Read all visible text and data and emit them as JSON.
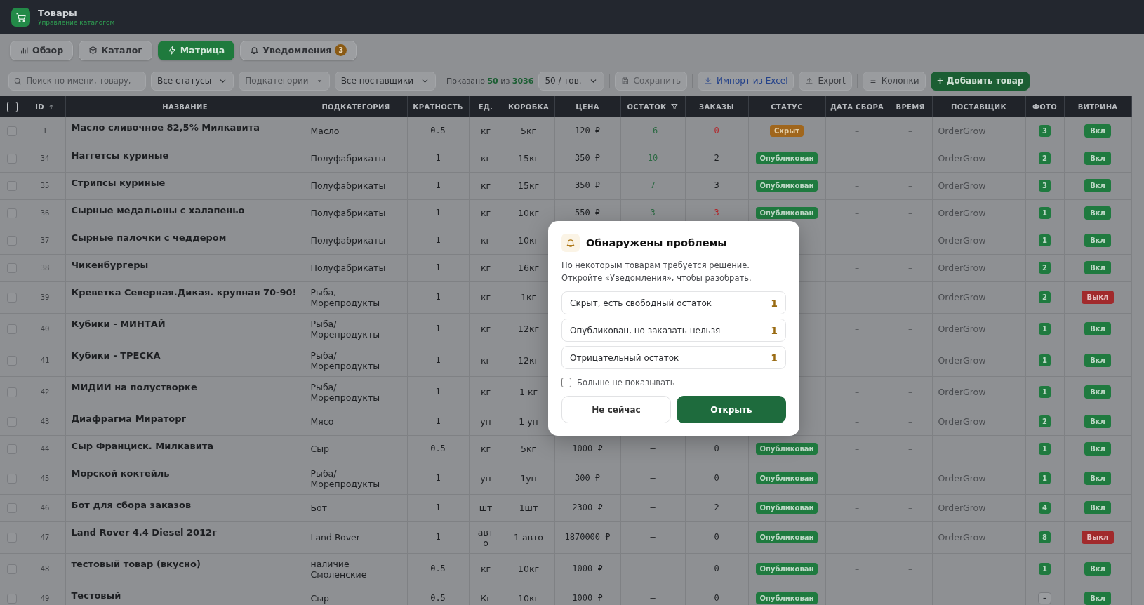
{
  "header": {
    "title": "Товары",
    "subtitle": "Управление каталогом"
  },
  "tabs": [
    {
      "label": "Обзор",
      "selected": false
    },
    {
      "label": "Каталог",
      "selected": false
    },
    {
      "label": "Матрица",
      "selected": true
    },
    {
      "label": "Уведомления",
      "selected": false,
      "badge": "3"
    }
  ],
  "toolbar": {
    "search": {
      "placeholder": "Поиск по имени, товару,"
    },
    "filters": [
      {
        "label": "Все статусы",
        "disabled": false
      },
      {
        "label": "Подкатегории",
        "disabled": true
      },
      {
        "label": "Все поставщики",
        "disabled": false
      }
    ],
    "shown": "Показано **50** из **3036**",
    "page_size": "50 / тов.",
    "actions": [
      {
        "label": "Сохранить",
        "kind": "save"
      },
      {
        "label": "Импорт из Excel",
        "kind": "import"
      },
      {
        "label": "Export",
        "kind": "export"
      },
      {
        "label": "Колонки",
        "kind": "columns"
      },
      {
        "label": "+ Добавить товар",
        "kind": "primary"
      }
    ]
  },
  "table": {
    "select_all": {
      "checked": false
    },
    "columns": [
      {
        "label": "ID",
        "kind": "sorted"
      },
      {
        "label": "НАЗВАНИЕ",
        "kind": "plain"
      },
      {
        "label": "ПОДКАТЕГОРИЯ",
        "kind": "plain"
      },
      {
        "label": "КРАТНОСТЬ",
        "kind": "plain"
      },
      {
        "label": "ЕД.",
        "kind": "plain"
      },
      {
        "label": "КОРОБКА",
        "kind": "plain"
      },
      {
        "label": "ЦЕНА",
        "kind": "plain"
      },
      {
        "label": "ОСТАТОК",
        "kind": "filter"
      },
      {
        "label": "ЗАКАЗЫ",
        "kind": "plain"
      },
      {
        "label": "СТАТУС",
        "kind": "plain"
      },
      {
        "label": "ДАТА СБОРА",
        "kind": "plain"
      },
      {
        "label": "ВРЕМЯ",
        "kind": "plain"
      },
      {
        "label": "ПОСТАВЩИК",
        "kind": "plain"
      },
      {
        "label": "ФОТО",
        "kind": "plain"
      },
      {
        "label": "ВИТРИНА",
        "kind": "plain"
      }
    ],
    "rows": [
      {
        "checked": false,
        "id": "1",
        "name": "Масло сливочное 82,5% Милкавита",
        "subcategory": "Масло",
        "multiple": "0.5",
        "unit": "кг",
        "box": "5кг",
        "price": "120 ₽",
        "stock": {
          "text": "-6",
          "color": "#2d6a44"
        },
        "orders": {
          "text": "0",
          "color": "#b3262b"
        },
        "status": {
          "kind": "hidden",
          "label": "Скрыт"
        },
        "collect_date": "–",
        "time": "–",
        "supplier": "OrderGrow",
        "photo": {
          "kind": "count",
          "text": "3"
        },
        "showcase": {
          "on": true,
          "label": "Вкл"
        }
      },
      {
        "checked": false,
        "id": "34",
        "name": "Наггетсы куриные",
        "subcategory": "Полуфабрикаты",
        "multiple": "1",
        "unit": "кг",
        "box": "15кг",
        "price": "350 ₽",
        "stock": {
          "text": "10",
          "color": "#2d6a44"
        },
        "orders": {
          "text": "2"
        },
        "status": {
          "kind": "published",
          "label": "Опубликован"
        },
        "collect_date": "–",
        "time": "–",
        "supplier": "OrderGrow",
        "photo": {
          "kind": "count",
          "text": "2"
        },
        "showcase": {
          "on": true,
          "label": "Вкл"
        }
      },
      {
        "checked": false,
        "id": "35",
        "name": "Стрипсы куриные",
        "subcategory": "Полуфабрикаты",
        "multiple": "1",
        "unit": "кг",
        "box": "15кг",
        "price": "350 ₽",
        "stock": {
          "text": "7",
          "color": "#2d6a44"
        },
        "orders": {
          "text": "3"
        },
        "status": {
          "kind": "published",
          "label": "Опубликован"
        },
        "collect_date": "–",
        "time": "–",
        "supplier": "OrderGrow",
        "photo": {
          "kind": "count",
          "text": "3"
        },
        "showcase": {
          "on": true,
          "label": "Вкл"
        }
      },
      {
        "checked": false,
        "id": "36",
        "name": "Сырные медальоны с халапеньо",
        "subcategory": "Полуфабрикаты",
        "multiple": "1",
        "unit": "кг",
        "box": "10кг",
        "price": "550 ₽",
        "stock": {
          "text": "3",
          "color": "#2d6a44"
        },
        "orders": {
          "text": "3",
          "color": "#b3262b"
        },
        "status": {
          "kind": "published",
          "label": "Опубликован"
        },
        "collect_date": "–",
        "time": "–",
        "supplier": "OrderGrow",
        "photo": {
          "kind": "count",
          "text": "1"
        },
        "showcase": {
          "on": true,
          "label": "Вкл"
        }
      },
      {
        "checked": false,
        "id": "37",
        "name": "Сырные палочки с чеддером",
        "subcategory": "Полуфабрикаты",
        "multiple": "1",
        "unit": "кг",
        "box": "10кг",
        "collect_date": "–",
        "time": "–",
        "supplier": "OrderGrow",
        "photo": {
          "kind": "count",
          "text": "1"
        },
        "showcase": {
          "on": true,
          "label": "Вкл"
        }
      },
      {
        "checked": false,
        "id": "38",
        "name": "Чикенбургеры",
        "subcategory": "Полуфабрикаты",
        "multiple": "1",
        "unit": "кг",
        "box": "16кг",
        "collect_date": "–",
        "time": "–",
        "supplier": "OrderGrow",
        "photo": {
          "kind": "count",
          "text": "2"
        },
        "showcase": {
          "on": true,
          "label": "Вкл"
        }
      },
      {
        "checked": false,
        "id": "39",
        "name": "Креветка Северная.Дикая. крупная 70-90!",
        "subcategory": "Рыба, Морепродукты",
        "multiple": "1",
        "unit": "кг",
        "box": "1кг",
        "collect_date": "–",
        "time": "–",
        "supplier": "OrderGrow",
        "photo": {
          "kind": "count",
          "text": "2"
        },
        "showcase": {
          "on": false,
          "label": "Выкл"
        }
      },
      {
        "checked": false,
        "id": "40",
        "name": "Кубики - МИНТАЙ",
        "subcategory": "Рыба/ Морепродукты",
        "multiple": "1",
        "unit": "кг",
        "box": "12кг",
        "collect_date": "–",
        "time": "–",
        "supplier": "OrderGrow",
        "photo": {
          "kind": "count",
          "text": "1"
        },
        "showcase": {
          "on": true,
          "label": "Вкл"
        }
      },
      {
        "checked": false,
        "id": "41",
        "name": "Кубики - ТРЕСКА",
        "subcategory": "Рыба/ Морепродукты",
        "multiple": "1",
        "unit": "кг",
        "box": "12кг",
        "collect_date": "–",
        "time": "–",
        "supplier": "OrderGrow",
        "photo": {
          "kind": "count",
          "text": "1"
        },
        "showcase": {
          "on": true,
          "label": "Вкл"
        }
      },
      {
        "checked": false,
        "id": "42",
        "name": "МИДИИ на полустворке",
        "subcategory": "Рыба/ Морепродукты",
        "multiple": "1",
        "unit": "кг",
        "box": "1 кг",
        "collect_date": "–",
        "time": "–",
        "supplier": "OrderGrow",
        "photo": {
          "kind": "count",
          "text": "1"
        },
        "showcase": {
          "on": true,
          "label": "Вкл"
        }
      },
      {
        "checked": false,
        "id": "43",
        "name": "Диафрагма Мираторг",
        "subcategory": "Мясо",
        "multiple": "1",
        "unit": "уп",
        "box": "1 уп",
        "collect_date": "–",
        "time": "–",
        "supplier": "OrderGrow",
        "photo": {
          "kind": "count",
          "text": "2"
        },
        "showcase": {
          "on": true,
          "label": "Вкл"
        }
      },
      {
        "checked": false,
        "id": "44",
        "name": "Сыр Франциск. Милкавита",
        "subcategory": "Сыр",
        "multiple": "0.5",
        "unit": "кг",
        "box": "5кг",
        "price": "1000 ₽",
        "stock": {
          "text": "–"
        },
        "orders": {
          "text": "0"
        },
        "status": {
          "kind": "published",
          "label": "Опубликован"
        },
        "collect_date": "–",
        "time": "–",
        "photo": {
          "kind": "count",
          "text": "1"
        },
        "showcase": {
          "on": true,
          "label": "Вкл"
        }
      },
      {
        "checked": false,
        "id": "45",
        "name": "Морской коктейль",
        "subcategory": "Рыба/ Морепродукты",
        "multiple": "1",
        "unit": "уп",
        "box": "1уп",
        "price": "300 ₽",
        "stock": {
          "text": "–"
        },
        "orders": {
          "text": "0"
        },
        "status": {
          "kind": "published",
          "label": "Опубликован"
        },
        "collect_date": "–",
        "time": "–",
        "supplier": "OrderGrow",
        "photo": {
          "kind": "count",
          "text": "1"
        },
        "showcase": {
          "on": true,
          "label": "Вкл"
        }
      },
      {
        "checked": false,
        "id": "46",
        "name": "Бот для сбора заказов",
        "subcategory": "Бот",
        "multiple": "1",
        "unit": "шт",
        "box": "1шт",
        "price": "2300 ₽",
        "stock": {
          "text": "–"
        },
        "orders": {
          "text": "2"
        },
        "status": {
          "kind": "published",
          "label": "Опубликован"
        },
        "collect_date": "–",
        "time": "–",
        "supplier": "OrderGrow",
        "photo": {
          "kind": "count",
          "text": "4"
        },
        "showcase": {
          "on": true,
          "label": "Вкл"
        }
      },
      {
        "checked": false,
        "id": "47",
        "name": "Land Rover 4.4 Diesel 2012г",
        "subcategory": "Land Rover",
        "multiple": "1",
        "unit": "авто",
        "box": "1 авто",
        "price": "1870000 ₽",
        "stock": {
          "text": "–"
        },
        "orders": {
          "text": "0"
        },
        "status": {
          "kind": "published",
          "label": "Опубликован"
        },
        "collect_date": "–",
        "time": "–",
        "supplier": "OrderGrow",
        "photo": {
          "kind": "count",
          "text": "8"
        },
        "showcase": {
          "on": false,
          "label": "Выкл"
        }
      },
      {
        "checked": false,
        "id": "48",
        "name": "тестовый товар (вкусно)",
        "subcategory": "наличие Смоленские",
        "multiple": "0.5",
        "unit": "кг",
        "box": "10кг",
        "price": "1000 ₽",
        "stock": {
          "text": "–"
        },
        "orders": {
          "text": "0"
        },
        "status": {
          "kind": "published",
          "label": "Опубликован"
        },
        "collect_date": "–",
        "time": "–",
        "photo": {
          "kind": "count",
          "text": "1"
        },
        "showcase": {
          "on": true,
          "label": "Вкл"
        }
      },
      {
        "checked": false,
        "id": "49",
        "name": "Тестовый",
        "subcategory": "Сыр",
        "multiple": "0.5",
        "unit": "Кг",
        "box": "10кг",
        "price": "1000 ₽",
        "stock": {
          "text": "–"
        },
        "orders": {
          "text": "0"
        },
        "status": {
          "kind": "published",
          "label": "Опубликован"
        },
        "collect_date": "–",
        "time": "–",
        "photo": {
          "kind": "none",
          "text": "–"
        },
        "showcase": {
          "on": true,
          "label": "Вкл"
        }
      }
    ]
  },
  "modal": {
    "title": "Обнаружены проблемы",
    "text": "По некоторым товарам требуется решение. Откройте «Уведомления», чтобы разобрать.",
    "issues": [
      {
        "label": "Скрыт, есть свободный остаток",
        "count": "1"
      },
      {
        "label": "Опубликован, но заказать нельзя",
        "count": "1"
      },
      {
        "label": "Отрицательный остаток",
        "count": "1"
      }
    ],
    "dont_show": {
      "label": "Больше не показывать",
      "checked": false
    },
    "buttons": [
      {
        "label": "Не сейчас",
        "kind": "secondary"
      },
      {
        "label": "Открыть",
        "kind": "primary"
      }
    ]
  }
}
